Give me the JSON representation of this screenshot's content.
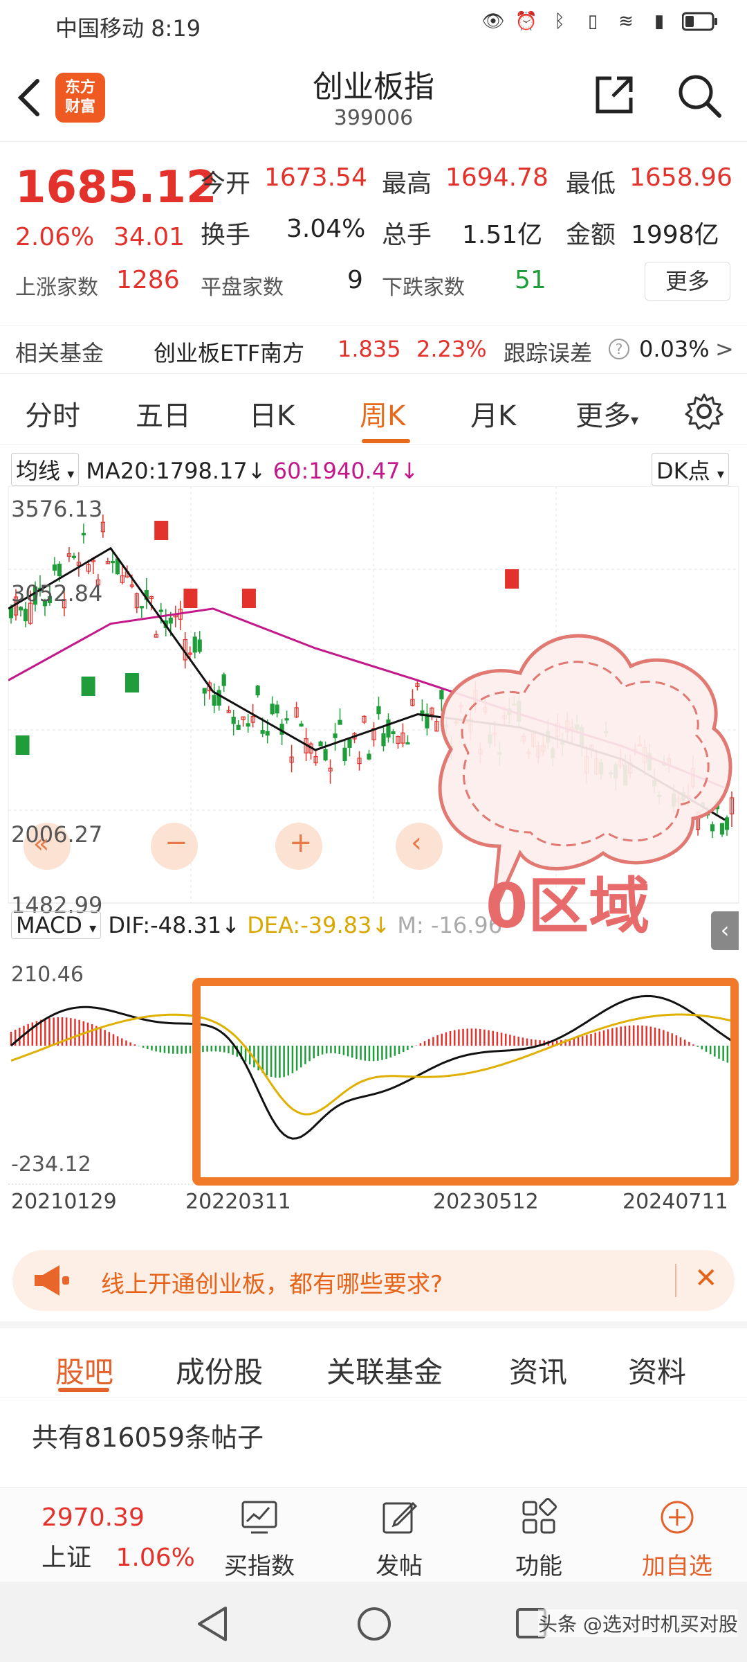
{
  "status_bar": {
    "carrier": "中国移动",
    "time": "8:19"
  },
  "nav": {
    "title": "创业板指",
    "code": "399006",
    "logo_text_1": "东方",
    "logo_text_2": "财富"
  },
  "quote": {
    "price": "1685.12",
    "change_pct": "2.06%",
    "change_amt": "34.01",
    "open_label": "今开",
    "open": "1673.54",
    "high_label": "最高",
    "high": "1694.78",
    "low_label": "最低",
    "low": "1658.96",
    "turnover_label": "换手",
    "turnover": "3.04%",
    "volume_label": "总手",
    "volume": "1.51亿",
    "amount_label": "金额",
    "amount": "1998亿",
    "up_label": "上涨家数",
    "up": "1286",
    "flat_label": "平盘家数",
    "flat": "9",
    "down_label": "下跌家数",
    "down": "51",
    "more_label": "更多"
  },
  "fund": {
    "label": "相关基金",
    "name": "创业板ETF南方",
    "price": "1.835",
    "pct": "2.23%",
    "track_label": "跟踪误差",
    "track_value": "0.03%",
    "chevron": ">"
  },
  "ktabs": {
    "items": [
      "分时",
      "五日",
      "日K",
      "周K",
      "月K",
      "更多"
    ],
    "active": "周K"
  },
  "chart_header": {
    "ma_select": "均线",
    "ma20": "MA20:1798.17↓",
    "ma60": "60:1940.47↓",
    "dk_label": "DK点"
  },
  "price_axis": {
    "top": "3576.13",
    "mid": "3052.84",
    "low": "2006.27",
    "bottom": "1482.99"
  },
  "macd_header": {
    "select": "MACD",
    "dif": "DIF:-48.31↓",
    "dea": "DEA:-39.83↓",
    "macd": "M: -16.96"
  },
  "macd_axis": {
    "top": "210.46",
    "bottom": "-234.12"
  },
  "dates": [
    "20210129",
    "20220311",
    "20230512",
    "20240711"
  ],
  "annotation": {
    "cloud_text": "0区域"
  },
  "chart_controls": [
    "«",
    "−",
    "+",
    "‹"
  ],
  "chart_data": {
    "type": "line",
    "title": "",
    "x": [
      "20210129",
      "20220311",
      "20230512",
      "20240711"
    ],
    "ylim": [
      1482.99,
      3576.13
    ],
    "series": [
      {
        "name": "MA20",
        "values": [
          3000,
          3320,
          2560,
          2250,
          2440,
          2370,
          2200,
          1880
        ]
      },
      {
        "name": "MA60",
        "values": [
          2620,
          2920,
          3000,
          2790,
          2620,
          2440,
          2270,
          2050
        ]
      }
    ]
  },
  "banner": {
    "text": "线上开通创业板，都有哪些要求?",
    "close": "✕"
  },
  "btabs": {
    "items": [
      "股吧",
      "成份股",
      "关联基金",
      "资讯",
      "资料"
    ],
    "active": "股吧"
  },
  "posts": {
    "text": "共有816059条帖子"
  },
  "toolbar": {
    "index_value": "2970.39",
    "index_name": "上证",
    "index_pct": "1.06%",
    "items": [
      "买指数",
      "发帖",
      "功能",
      "加自选"
    ]
  },
  "watermark": "头条 @选对时机买对股",
  "colors": {
    "up": "#e3312b",
    "down": "#1f9d3a",
    "accent": "#e66a1a",
    "ma60": "#c2188a",
    "dea": "#e0b000"
  }
}
